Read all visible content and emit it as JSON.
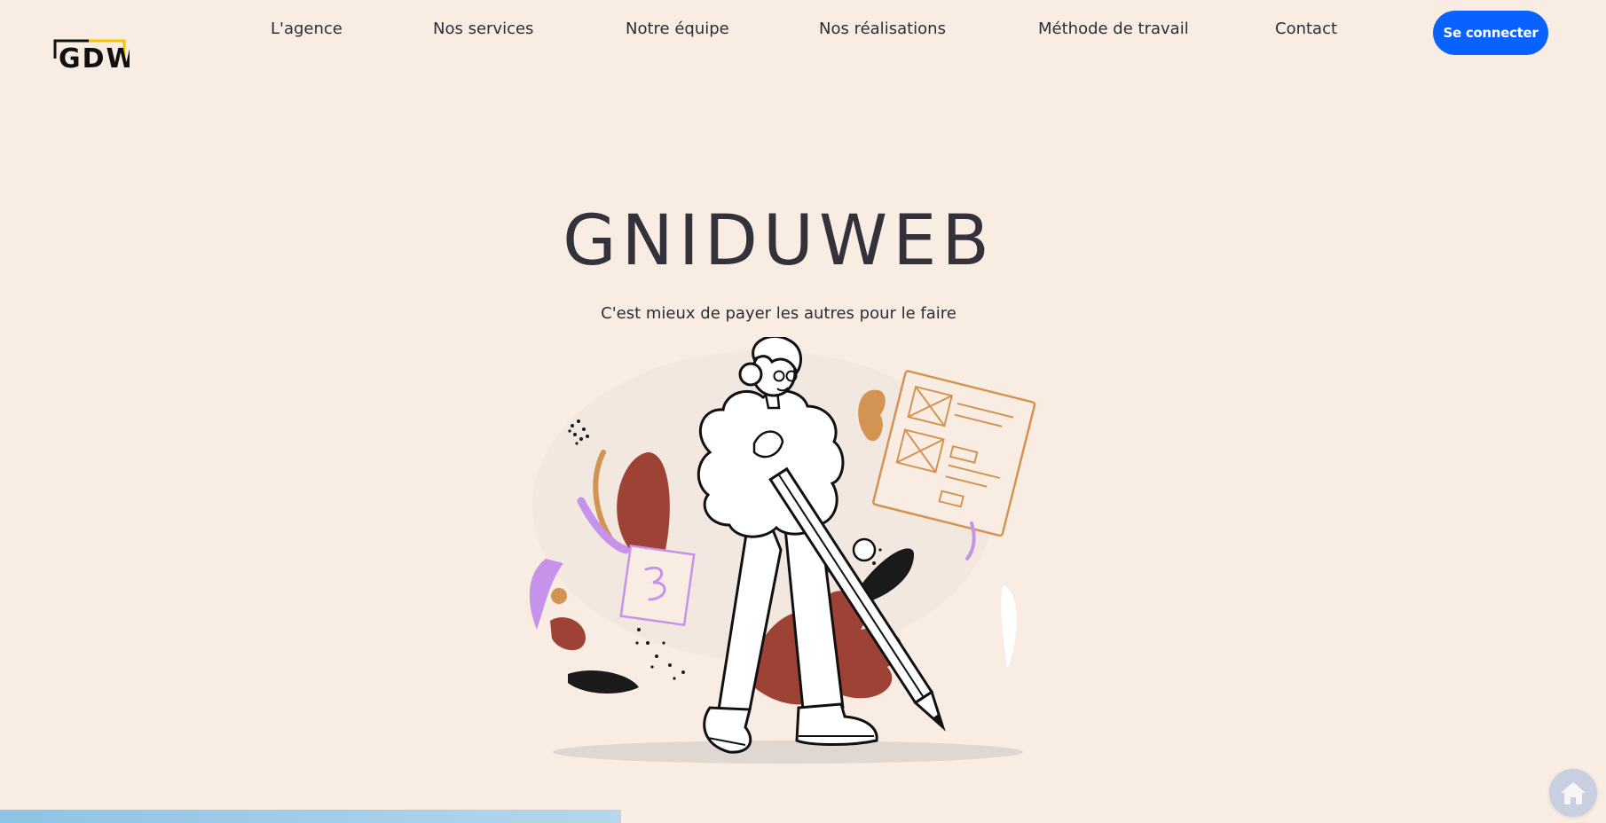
{
  "brand": {
    "logo_text": "GDW",
    "logo_colors": {
      "stroke": "#111111",
      "accent": "#f2c500"
    }
  },
  "nav": {
    "items": [
      {
        "label": "L'agence"
      },
      {
        "label": "Nos services"
      },
      {
        "label": "Notre équipe"
      },
      {
        "label": "Nos réalisations"
      },
      {
        "label": "Méthode de travail"
      },
      {
        "label": "Contact"
      }
    ],
    "login_label": "Se connecter"
  },
  "hero": {
    "title": "GNIDUWEB",
    "subtitle": "C'est mieux de payer les autres pour le faire",
    "illustration": "woman-with-giant-pencil-illustration"
  },
  "floating_button": {
    "icon": "home-icon"
  },
  "colors": {
    "background": "#f9ede3",
    "accent_blue": "#0862ff",
    "text_dark": "#33323a",
    "rust": "#9e4235",
    "ochre": "#d39352",
    "lavender": "#c593ea"
  }
}
